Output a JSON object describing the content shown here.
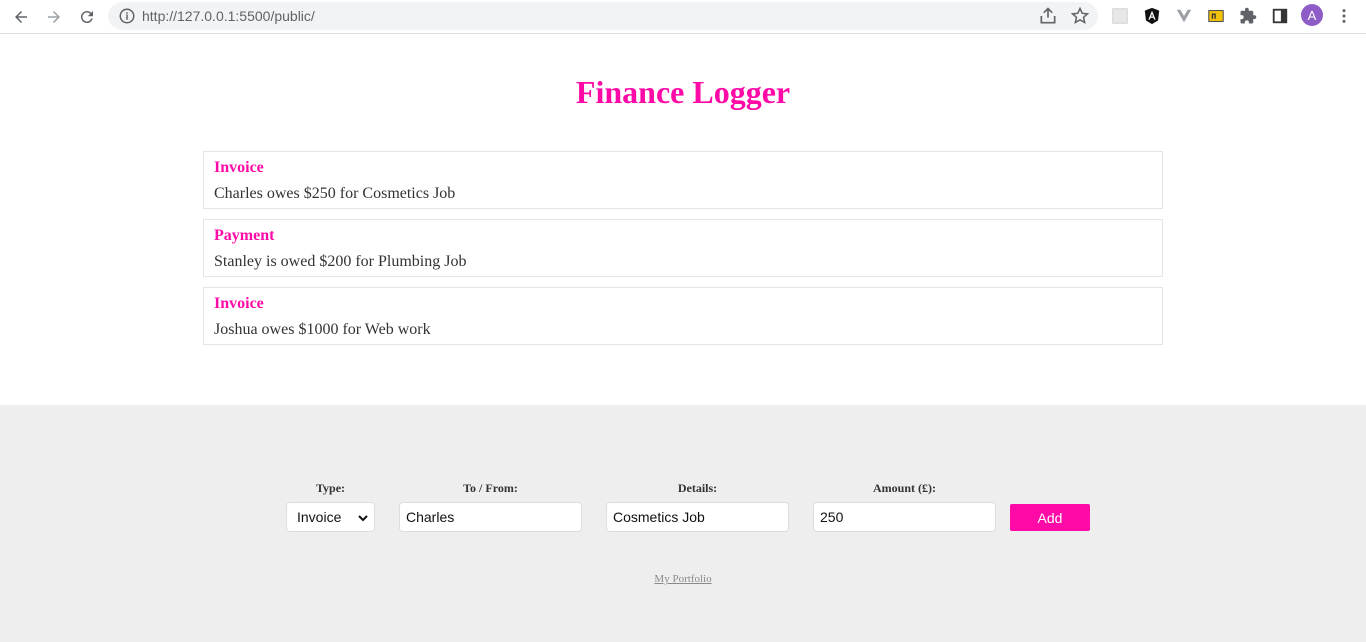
{
  "browser": {
    "url": "http://127.0.0.1:5500/public/",
    "avatar_letter": "A"
  },
  "page": {
    "title": "Finance Logger"
  },
  "items": [
    {
      "type": "Invoice",
      "text": "Charles owes $250 for Cosmetics Job"
    },
    {
      "type": "Payment",
      "text": "Stanley is owed $200 for Plumbing Job"
    },
    {
      "type": "Invoice",
      "text": "Joshua owes $1000 for Web work"
    }
  ],
  "form": {
    "type_label": "Type:",
    "type_value": "Invoice",
    "tofrom_label": "To / From:",
    "tofrom_value": "Charles",
    "details_label": "Details:",
    "details_value": "Cosmetics Job",
    "amount_label": "Amount (£):",
    "amount_value": "250",
    "add_label": "Add"
  },
  "footer": {
    "portfolio_link": "My Portfolio"
  },
  "colors": {
    "accent": "#ff0aa7",
    "footer_bg": "#eeeeee"
  }
}
